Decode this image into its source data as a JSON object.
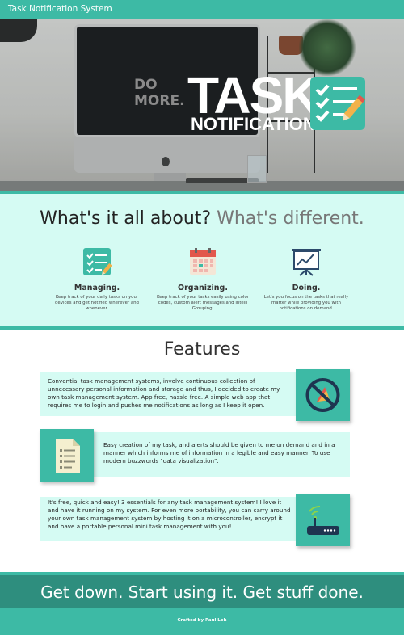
{
  "header": {
    "brand": "Task Notification System"
  },
  "hero": {
    "title": "TASK",
    "subtitle": "NOTIFICATION",
    "photo_text": [
      "DO",
      "MORE."
    ],
    "badge_icon": "checklist-pencil-icon"
  },
  "about": {
    "heading_dark": "What's it all about?",
    "heading_light": "What's different.",
    "items": [
      {
        "icon": "checklist-icon",
        "title": "Managing.",
        "desc": "Keep track of your daily tasks on your devices and get notified wherever and whenever."
      },
      {
        "icon": "calendar-icon",
        "title": "Organizing.",
        "desc": "Keep track of your tasks easily using color codes, custom alert messages and Intelli Grouping."
      },
      {
        "icon": "presentation-chart-icon",
        "title": "Doing.",
        "desc": "Let's you focus on the tasks that really matter while providing you with notifications on demand."
      }
    ]
  },
  "features": {
    "title": "Features",
    "cards": [
      {
        "icon": "no-paper-icon",
        "text": "Convential task management systems, involve continuous collection of unnecessary personal information and storage and thus, I decided to create my own task management system. App free, hassle free. A simple web app that requires me to login and pushes me notifications as long as I keep it open."
      },
      {
        "icon": "document-icon",
        "text": "Easy creation of my task, and alerts should be given to me on demand and in a manner which informs me of information in a legible and easy manner. To use modern buzzwords \"data visualization\"."
      },
      {
        "icon": "router-icon",
        "text": "It's free, quick and easy! 3 essentials for any task management system! I love it and have it running on my system. For even more portability, you can carry around your own task management system by hosting it on a microcontroller, encrypt it and have a portable personal mini task management with you!"
      }
    ]
  },
  "cta": {
    "text": "Get down. Start using it. Get stuff done."
  },
  "footer": {
    "credit": "Crafted by Paul Loh"
  },
  "colors": {
    "primary": "#3dbaa5",
    "dark": "#2e8e7e",
    "light": "#d5fbf3"
  }
}
